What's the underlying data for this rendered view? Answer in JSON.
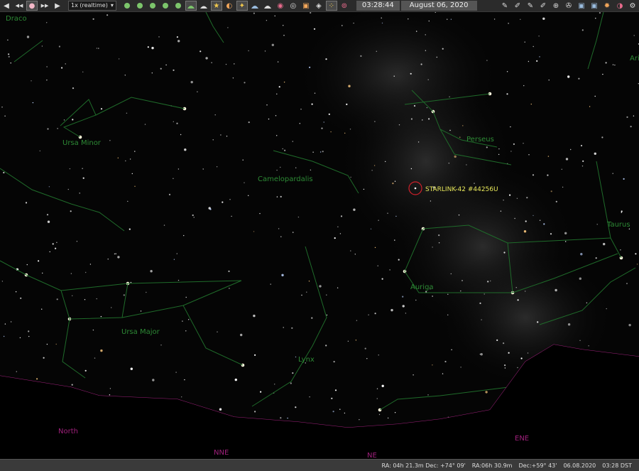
{
  "toolbar": {
    "left_buttons": [
      {
        "icon": "rewind-icon",
        "glyph": "◀"
      },
      {
        "icon": "fast-rewind-icon",
        "glyph": "◀◀"
      },
      {
        "icon": "real-time-icon",
        "glyph": "●"
      },
      {
        "icon": "fast-forward-icon",
        "glyph": "▶▶"
      },
      {
        "icon": "play-icon",
        "glyph": "▶"
      }
    ],
    "speed_value": "1x (realtime)",
    "time": "03:28:44",
    "date": "August 06, 2020"
  },
  "sky": {
    "constellations": [
      "Draco",
      "Ursa Minor",
      "Camelopardalis",
      "Perseus",
      "Taurus",
      "Auriga",
      "Ursa Major",
      "Lynx",
      "Ari"
    ],
    "directions": [
      "North",
      "NNE",
      "NE",
      "ENE"
    ],
    "satellite_label": "STARLINK-42 #44256U"
  },
  "status": {
    "ra_dec_j2000": "RA: 04h 21.3m Dec: +74° 09'",
    "ra": "RA:06h 30.9m",
    "dec": "Dec:+59° 43'",
    "date": "06.08.2020",
    "time": "03:28 DST"
  },
  "colors": {
    "constellation_line": "#1f6b2a",
    "constellation_label": "#2d8a35",
    "horizon": "#a0207c",
    "satellite_marker": "#d0202a",
    "satellite_label": "#e8e85a"
  }
}
